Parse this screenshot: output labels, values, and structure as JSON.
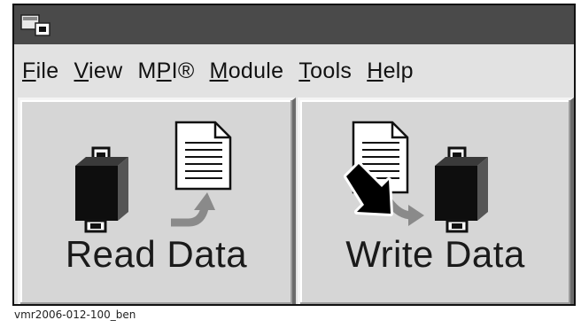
{
  "menu": {
    "file": {
      "u": "F",
      "rest": "ile"
    },
    "view": {
      "u": "V",
      "rest": "iew"
    },
    "mpi": {
      "pre": "M",
      "u": "P",
      "rest": "I®"
    },
    "module": {
      "u": "M",
      "rest": "odule"
    },
    "tools": {
      "u": "T",
      "rest": "ools"
    },
    "help": {
      "u": "H",
      "rest": "elp"
    }
  },
  "buttons": {
    "read_label": "Read Data",
    "write_label": "Write Data"
  },
  "caption": "vmr2006-012-100_ben",
  "icons": {
    "app": "module-app-icon",
    "module": "module-chip-icon",
    "document": "document-icon",
    "arrow": "curved-arrow-icon",
    "cursor": "mouse-pointer-icon"
  },
  "colors": {
    "title_bar": "#4a4a4a",
    "window": "#e2e2e2",
    "button_face": "#d6d6d6"
  }
}
